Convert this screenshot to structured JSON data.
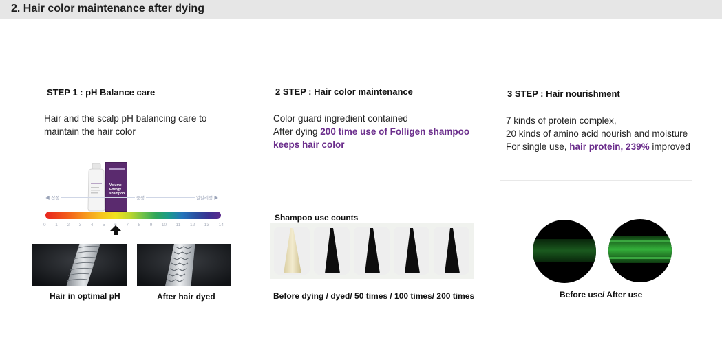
{
  "header": {
    "title": "2. Hair color maintenance after dying"
  },
  "step1": {
    "title": "STEP 1 : pH Balance care",
    "lines": [
      "Hair and the scalp pH balancing care to",
      "maintain the hair color"
    ],
    "scale": {
      "left_label": "◀ 산성",
      "mid_label": "중성",
      "right_label": "알칼리성 ▶",
      "ticks": [
        "0",
        "1",
        "2",
        "3",
        "4",
        "5",
        "6",
        "7",
        "8",
        "9",
        "10",
        "11",
        "12",
        "13",
        "14"
      ]
    },
    "bottle_label": [
      "Volume",
      "Energy",
      "shampoo"
    ],
    "captions": [
      "Hair in optimal pH",
      "After hair dyed"
    ]
  },
  "step2": {
    "title": "2 STEP : Hair color maintenance",
    "line1": "Color guard ingredient contained",
    "line2_plain": "After dying ",
    "line2_highlight": "200 time use of Folligen shampoo",
    "line3_highlight": "keeps hair color",
    "strip_title": "Shampoo use counts",
    "caption": "Before dying / dyed/ 50 times / 100 times/ 200 times"
  },
  "step3": {
    "title": "3 STEP : Hair nourishment",
    "line1": "7 kinds of protein complex,",
    "line2": "20 kinds of amino acid nourish and moisture",
    "line3_plain": "For single use, ",
    "line3_highlight": "hair protein, 239%",
    "line3_tail": " improved",
    "caption": "Before use/ After use"
  },
  "colors": {
    "highlight": "#6b2e8c",
    "header_bg": "#e6e6e6",
    "bottle_purple": "#5a2a6e"
  }
}
